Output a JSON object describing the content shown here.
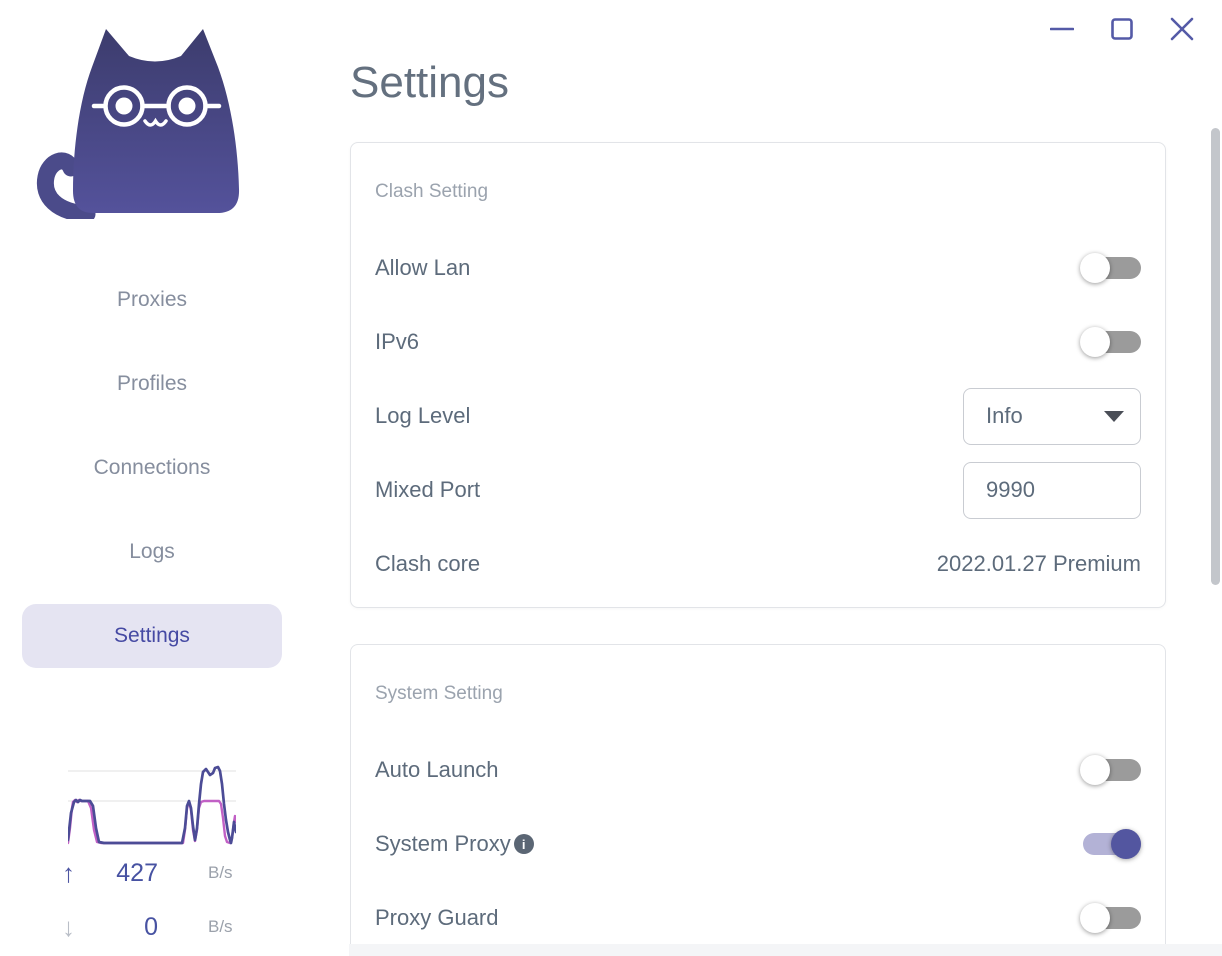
{
  "window": {
    "controls": [
      {
        "name": "minimize"
      },
      {
        "name": "maximize"
      },
      {
        "name": "close"
      }
    ]
  },
  "icons": {
    "info_glyph": "i",
    "up_arrow": "↑",
    "down_arrow": "↓"
  },
  "sidebar": {
    "items": [
      {
        "label": "Proxies",
        "active": false
      },
      {
        "label": "Profiles",
        "active": false
      },
      {
        "label": "Connections",
        "active": false
      },
      {
        "label": "Logs",
        "active": false
      },
      {
        "label": "Settings",
        "active": true
      }
    ],
    "traffic": {
      "up": {
        "value": "427",
        "unit": "B/s"
      },
      "down": {
        "value": "0",
        "unit": "B/s"
      }
    }
  },
  "page": {
    "title": "Settings"
  },
  "cards": [
    {
      "title": "Clash Setting",
      "rows": [
        {
          "label": "Allow Lan",
          "type": "toggle",
          "state": "off"
        },
        {
          "label": "IPv6",
          "type": "toggle",
          "state": "off"
        },
        {
          "label": "Log Level",
          "type": "select",
          "value": "Info"
        },
        {
          "label": "Mixed Port",
          "type": "input",
          "value": "9990"
        },
        {
          "label": "Clash core",
          "type": "text",
          "value": "2022.01.27 Premium"
        }
      ]
    },
    {
      "title": "System Setting",
      "rows": [
        {
          "label": "Auto Launch",
          "type": "toggle",
          "state": "off"
        },
        {
          "label": "System Proxy",
          "type": "toggle",
          "state": "on",
          "info": true
        },
        {
          "label": "Proxy Guard",
          "type": "toggle",
          "state": "off"
        }
      ]
    }
  ],
  "colors": {
    "accent": "#5356a0",
    "nav_active_bg": "#e5e4f2",
    "nav_active_text": "#4549a3",
    "toggle_on_track": "#b3b2d6",
    "toggle_off_track": "#9b9b9b",
    "upload_line": "#4c4c96",
    "download_line": "#c160c5",
    "title_text": "#64707f",
    "label_text": "#5d6b7b"
  }
}
